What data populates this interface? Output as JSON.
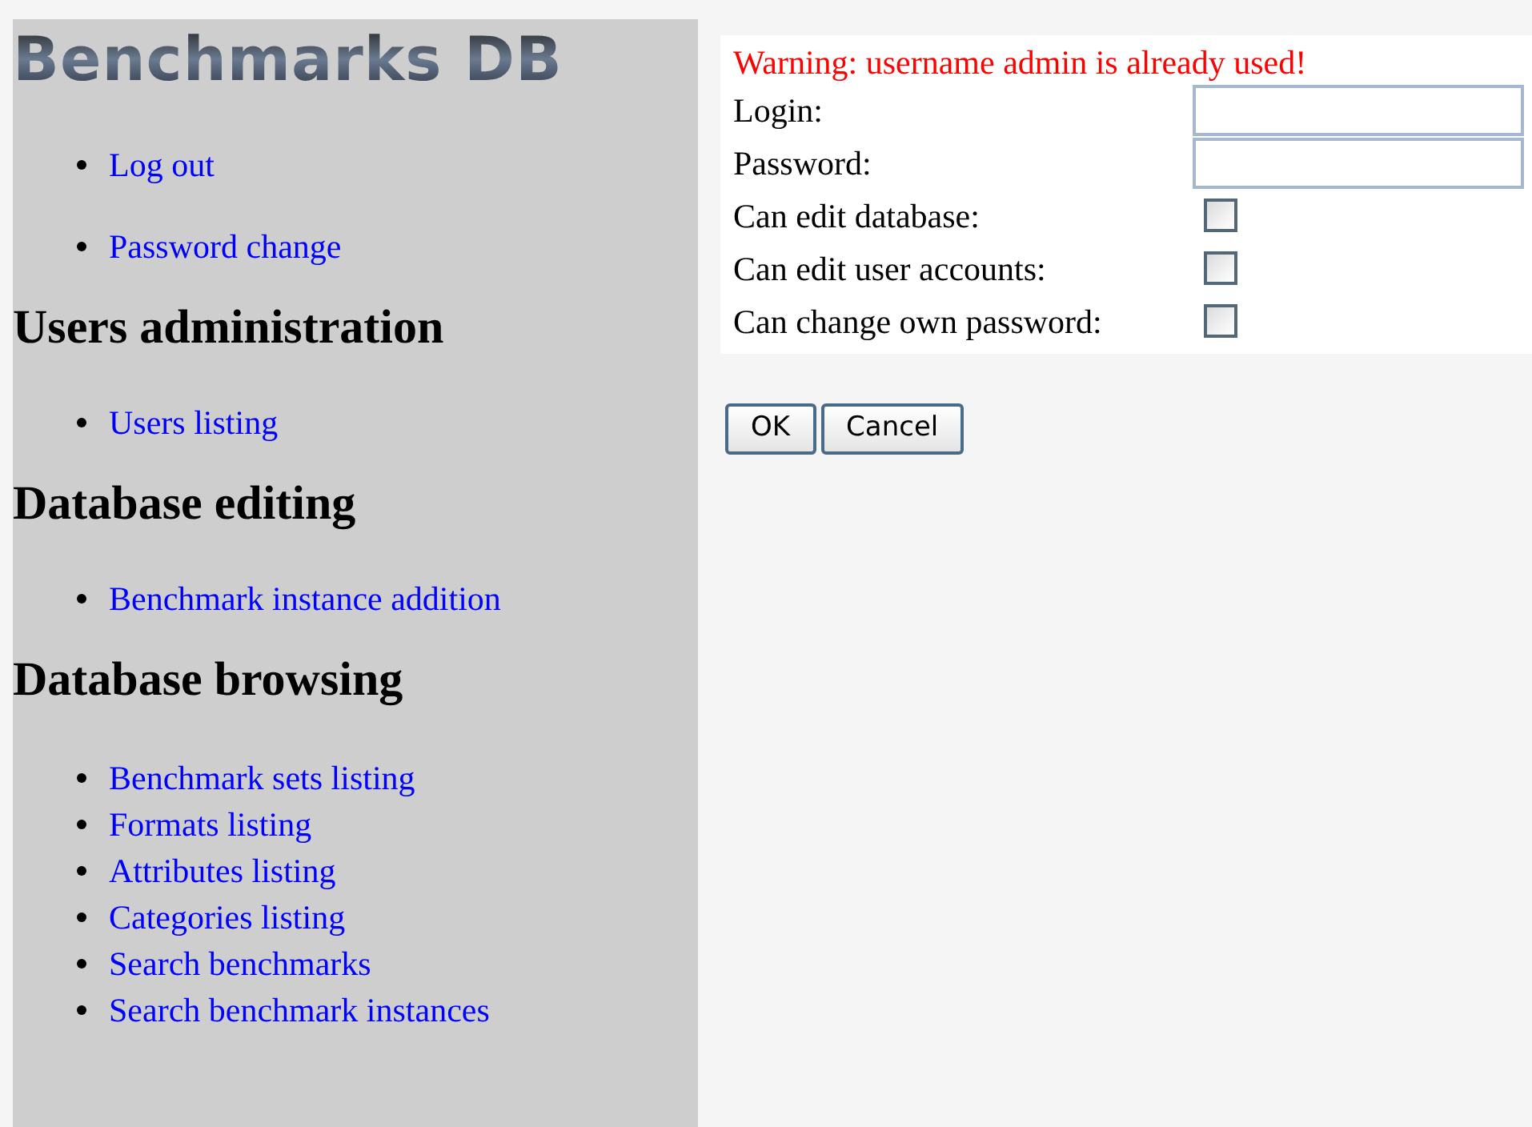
{
  "sidebar": {
    "logo": "Benchmarks DB",
    "sections": [
      {
        "items": [
          "Log out",
          "Password change"
        ]
      },
      {
        "heading": "Users administration",
        "items": [
          "Users listing"
        ]
      },
      {
        "heading": "Database editing",
        "items": [
          "Benchmark instance addition"
        ]
      },
      {
        "heading": "Database browsing",
        "items": [
          "Benchmark sets listing",
          "Formats listing",
          "Attributes listing",
          "Categories listing",
          "Search benchmarks",
          "Search benchmark instances"
        ]
      }
    ]
  },
  "form": {
    "warning": "Warning: username admin is already used!",
    "fields": [
      {
        "kind": "text",
        "label": "Login:"
      },
      {
        "kind": "text",
        "label": "Password:"
      },
      {
        "kind": "checkbox",
        "label": "Can edit database:",
        "checked": false
      },
      {
        "kind": "checkbox",
        "label": "Can edit user accounts:",
        "checked": false
      },
      {
        "kind": "checkbox",
        "label": "Can change own password:",
        "checked": false
      }
    ]
  },
  "buttons": [
    "OK",
    "Cancel"
  ]
}
